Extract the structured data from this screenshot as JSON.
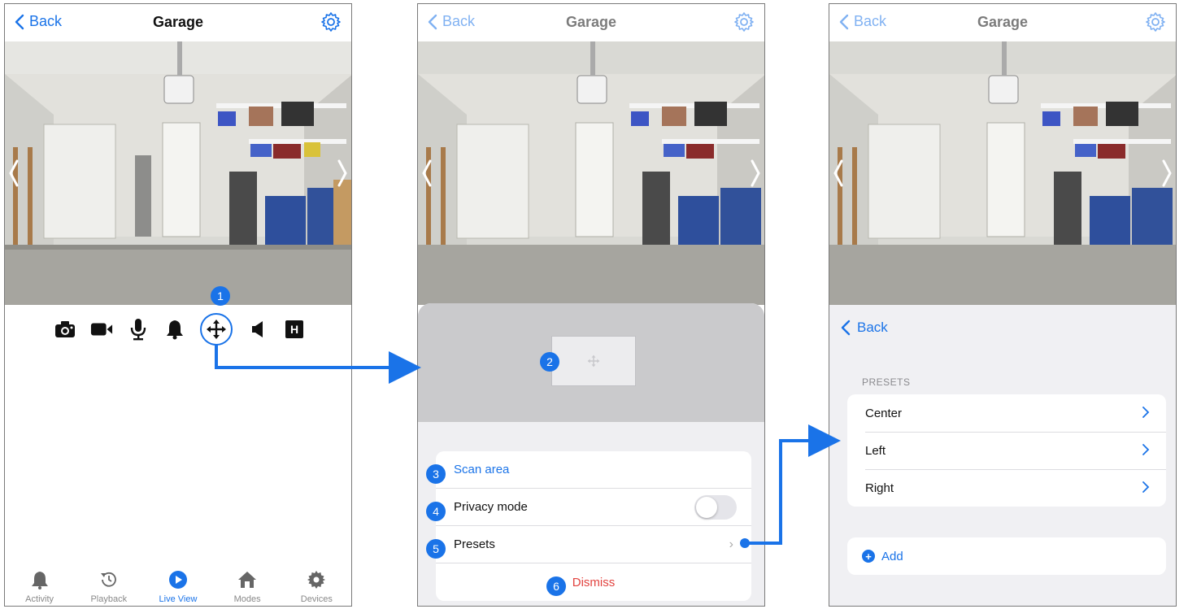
{
  "accent_color": "#1a73e8",
  "danger_color": "#e2433f",
  "screen1": {
    "header": {
      "back_label": "Back",
      "title": "Garage",
      "settings_icon": "gear-icon"
    },
    "controls": [
      "camera-icon",
      "video-icon",
      "microphone-icon",
      "bell-icon",
      "move-icon",
      "speaker-icon",
      "hd-icon"
    ],
    "hd_label": "H",
    "callout": "1",
    "tabs": [
      {
        "label": "Activity",
        "icon": "bell-icon"
      },
      {
        "label": "Playback",
        "icon": "history-icon"
      },
      {
        "label": "Live View",
        "icon": "play-icon",
        "active": true
      },
      {
        "label": "Modes",
        "icon": "home-icon"
      },
      {
        "label": "Devices",
        "icon": "gear-icon"
      }
    ]
  },
  "screen2": {
    "header": {
      "back_label": "Back",
      "title": "Garage"
    },
    "ptz_callout": "2",
    "menu": [
      {
        "callout": "3",
        "label": "Scan area"
      },
      {
        "callout": "4",
        "label": "Privacy mode",
        "toggle": false
      },
      {
        "callout": "5",
        "label": "Presets"
      },
      {
        "callout": "6",
        "label": "Dismiss"
      }
    ]
  },
  "screen3": {
    "header": {
      "back_label": "Back",
      "title": "Garage"
    },
    "back_label": "Back",
    "section_label": "PRESETS",
    "presets": [
      "Center",
      "Left",
      "Right"
    ],
    "add_label": "Add"
  }
}
